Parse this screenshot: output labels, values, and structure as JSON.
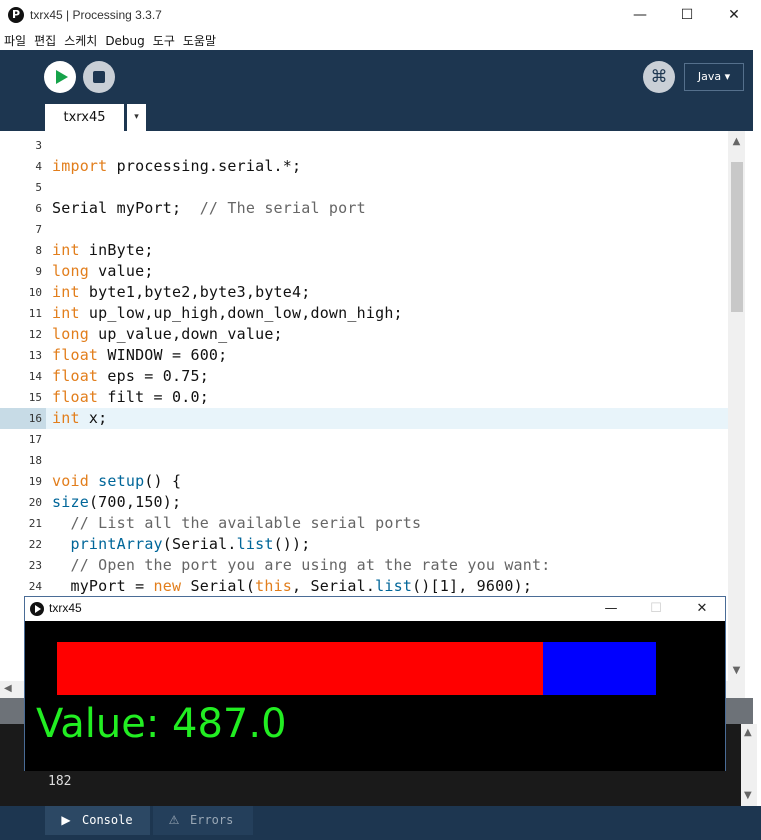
{
  "window": {
    "title": "txrx45 | Processing 3.3.7",
    "icon_letter": "P",
    "minimize": "—",
    "maximize": "☐",
    "close": "✕"
  },
  "menu": [
    "파일",
    "편집",
    "스케치",
    "Debug",
    "도구",
    "도움말"
  ],
  "toolbar": {
    "debug_glyph": "⌘",
    "mode_label": "Java ▾"
  },
  "tabs": [
    {
      "label": "txrx45"
    }
  ],
  "tab_menu_arrow": "▾",
  "editor": {
    "lines": [
      {
        "num": "3",
        "html": ""
      },
      {
        "num": "4",
        "html": "<span class=\"kw\">import</span> processing.serial.*;"
      },
      {
        "num": "5",
        "html": ""
      },
      {
        "num": "6",
        "html": "Serial myPort;  <span class=\"cm\">// The serial port</span>"
      },
      {
        "num": "7",
        "html": ""
      },
      {
        "num": "8",
        "html": "<span class=\"kw\">int</span> inByte;"
      },
      {
        "num": "9",
        "html": "<span class=\"kw\">long</span> value;"
      },
      {
        "num": "10",
        "html": "<span class=\"kw\">int</span> byte1,byte2,byte3,byte4;"
      },
      {
        "num": "11",
        "html": "<span class=\"kw\">int</span> up_low,up_high,down_low,down_high;"
      },
      {
        "num": "12",
        "html": "<span class=\"kw\">long</span> up_value,down_value;"
      },
      {
        "num": "13",
        "html": "<span class=\"kw\">float</span> WINDOW = 600;"
      },
      {
        "num": "14",
        "html": "<span class=\"kw\">float</span> eps = 0.75;"
      },
      {
        "num": "15",
        "html": "<span class=\"kw\">float</span> filt = 0.0;"
      },
      {
        "num": "16",
        "html": "<span class=\"kw\">int</span> x;"
      },
      {
        "num": "17",
        "html": ""
      },
      {
        "num": "18",
        "html": ""
      },
      {
        "num": "19",
        "html": "<span class=\"kw\">void</span> <span class=\"fn\">setup</span>() {"
      },
      {
        "num": "20",
        "html": "<span class=\"fn\">size</span>(700,150);"
      },
      {
        "num": "21",
        "html": "  <span class=\"cm\">// List all the available serial ports</span>"
      },
      {
        "num": "22",
        "html": "  <span class=\"fn\">printArray</span>(Serial.<span class=\"fn\">list</span>());"
      },
      {
        "num": "23",
        "html": "  <span class=\"cm\">// Open the port you are using at the rate you want:</span>"
      },
      {
        "num": "24",
        "html": "  myPort = <span class=\"kw\">new</span> Serial(<span class=\"kw\">this</span>, Serial.<span class=\"fn\">list</span>()[1], 9600);"
      }
    ],
    "active_line": "16"
  },
  "scroll": {
    "up": "▲",
    "down": "▼",
    "left": "◀"
  },
  "console": {
    "output": "182"
  },
  "bottom_tabs": [
    {
      "icon": "▶",
      "label": "Console"
    },
    {
      "icon": "⚠",
      "label": "Errors"
    }
  ],
  "sketch_window": {
    "title": "txrx45",
    "minimize": "—",
    "maximize": "☐",
    "close": "✕",
    "value_text": "Value: 487.0",
    "canvas_width": 700,
    "bars": [
      {
        "name": "red-bar",
        "color": "#ff0000",
        "start": 32,
        "end": 518
      },
      {
        "name": "blue-bar",
        "color": "#0000ff",
        "start": 518,
        "end": 631
      }
    ]
  },
  "colors": {
    "toolbar_bg": "#1d3650",
    "keyword": "#e27e1c",
    "function": "#006699",
    "comment": "#666666",
    "value_text": "#22ee22"
  }
}
